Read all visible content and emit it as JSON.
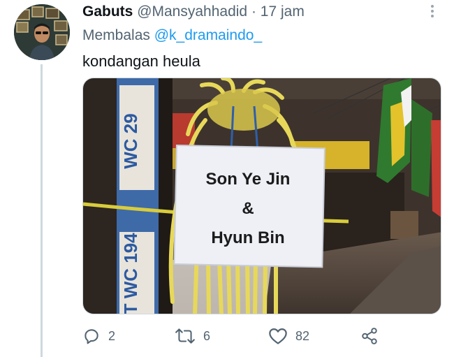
{
  "tweet": {
    "display_name": "Gabuts",
    "handle": "@Mansyahhadid",
    "separator": "·",
    "time": "17 jam",
    "replying_to_prefix": "Membalas",
    "replying_to_handle": "@k_dramaindo_",
    "text": "kondangan heula",
    "image": {
      "sign_line1": "Son Ye Jin",
      "sign_line2": "&",
      "sign_line3": "Hyun Bin",
      "icons": [
        "avatar-icon",
        "more-icon"
      ]
    }
  },
  "actions": {
    "reply_count": "2",
    "retweet_count": "6",
    "like_count": "82",
    "icons": [
      "reply-icon",
      "retweet-icon",
      "like-icon",
      "share-icon"
    ]
  },
  "colors": {
    "text": "#0f1419",
    "muted": "#536471",
    "link": "#1d9bf0",
    "thread_line": "#cfd9de"
  }
}
